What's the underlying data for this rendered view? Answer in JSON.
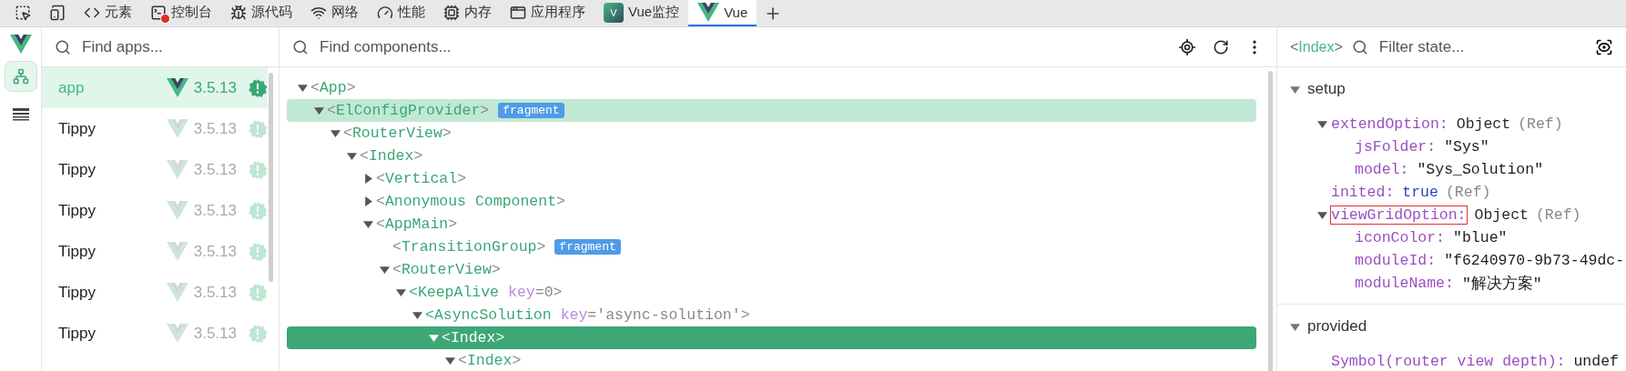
{
  "devtools_tabs": [
    {
      "kind": "inspect",
      "selected": false
    },
    {
      "kind": "device",
      "selected": false
    },
    {
      "kind": "elements",
      "label": "元素",
      "selected": false
    },
    {
      "kind": "console",
      "label": "控制台",
      "selected": false,
      "error": true
    },
    {
      "kind": "sources",
      "label": "源代码",
      "selected": false
    },
    {
      "kind": "network",
      "label": "网络",
      "selected": false
    },
    {
      "kind": "performance",
      "label": "性能",
      "selected": false
    },
    {
      "kind": "memory",
      "label": "内存",
      "selected": false
    },
    {
      "kind": "application",
      "label": "应用程序",
      "selected": false
    },
    {
      "kind": "vue-monitor",
      "label": "Vue监控",
      "letter": "V",
      "selected": false
    },
    {
      "kind": "vue",
      "label": "Vue",
      "selected": true
    }
  ],
  "rail": [
    {
      "kind": "components",
      "selected": true
    },
    {
      "kind": "timeline",
      "selected": false
    }
  ],
  "apps": {
    "search": {
      "placeholder": "Find apps..."
    },
    "items": [
      {
        "name": "app",
        "version": "3.5.13",
        "selected": true
      },
      {
        "name": "Tippy",
        "version": "3.5.13",
        "selected": false
      },
      {
        "name": "Tippy",
        "version": "3.5.13",
        "selected": false
      },
      {
        "name": "Tippy",
        "version": "3.5.13",
        "selected": false
      },
      {
        "name": "Tippy",
        "version": "3.5.13",
        "selected": false
      },
      {
        "name": "Tippy",
        "version": "3.5.13",
        "selected": false
      },
      {
        "name": "Tippy",
        "version": "3.5.13",
        "selected": false
      }
    ]
  },
  "components": {
    "search": {
      "placeholder": "Find components..."
    },
    "tree": [
      {
        "tag": "<App>",
        "kind": "branch",
        "expanded": true,
        "selected": false,
        "highlighted": false,
        "children": [
          {
            "tag": "<ElConfigProvider>",
            "kind": "branch",
            "expanded": true,
            "selected": false,
            "highlighted": true,
            "badge": "fragment",
            "children": [
              {
                "tag": "<RouterView>",
                "kind": "branch",
                "expanded": true,
                "selected": false,
                "highlighted": false,
                "children": [
                  {
                    "tag": "<Index>",
                    "kind": "branch",
                    "expanded": true,
                    "selected": false,
                    "highlighted": false,
                    "children": [
                      {
                        "tag": "<Vertical>",
                        "kind": "branch",
                        "expanded": false,
                        "selected": false,
                        "highlighted": false
                      },
                      {
                        "tag": "<Anonymous Component>",
                        "kind": "branch",
                        "expanded": false,
                        "selected": false,
                        "highlighted": false
                      },
                      {
                        "tag": "<AppMain>",
                        "kind": "branch",
                        "expanded": true,
                        "selected": false,
                        "highlighted": false,
                        "children": [
                          {
                            "tag": "<TransitionGroup>",
                            "kind": "leaf",
                            "selected": false,
                            "highlighted": false,
                            "badge": "fragment"
                          },
                          {
                            "tag": "<RouterView>",
                            "kind": "branch",
                            "expanded": true,
                            "selected": false,
                            "highlighted": false,
                            "children": [
                              {
                                "tag": "<KeepAlive",
                                "kind": "branch",
                                "expanded": true,
                                "selected": false,
                                "highlighted": false,
                                "key": "key",
                                "key_value": "=0",
                                "end": ">",
                                "children": [
                                  {
                                    "tag": "<AsyncSolution",
                                    "kind": "branch",
                                    "expanded": true,
                                    "selected": false,
                                    "highlighted": false,
                                    "key": "key",
                                    "key_value": "='async-solution'",
                                    "end": ">",
                                    "children": [
                                      {
                                        "tag": "<Index>",
                                        "kind": "branch",
                                        "expanded": true,
                                        "selected": true,
                                        "highlighted": false,
                                        "children": [
                                          {
                                            "tag": "<Index>",
                                            "kind": "branch",
                                            "expanded": true,
                                            "selected": false,
                                            "highlighted": false
                                          }
                                        ]
                                      }
                                    ]
                                  }
                                ]
                              }
                            ]
                          }
                        ]
                      }
                    ]
                  }
                ]
              }
            ]
          }
        ]
      }
    ]
  },
  "inspector": {
    "component": "<Index>",
    "search": {
      "placeholder": "Filter state..."
    },
    "sections": [
      {
        "title": "setup",
        "expanded": true,
        "items": [
          {
            "key": "extendOption:",
            "value": "Object",
            "kind": "object",
            "suffix": "(Ref)",
            "boxed": false,
            "expanded": true,
            "children": [
              {
                "key": "jsFolder:",
                "value": "\"Sys\"",
                "kind": "string",
                "boxed": false
              },
              {
                "key": "model:",
                "value": "\"Sys_Solution\"",
                "kind": "string",
                "boxed": false
              }
            ]
          },
          {
            "key": "inited:",
            "value": "true",
            "kind": "boolean",
            "suffix": "(Ref)",
            "boxed": false
          },
          {
            "key": "viewGridOption:",
            "value": "Object",
            "kind": "object",
            "suffix": "(Ref)",
            "boxed": true,
            "expanded": true,
            "children": [
              {
                "key": "iconColor:",
                "value": "\"blue\"",
                "kind": "string",
                "boxed": false
              },
              {
                "key": "moduleId:",
                "value": "\"f6240970-9b73-49dc-",
                "kind": "string",
                "boxed": false
              },
              {
                "key": "moduleName:",
                "value": "\"解决方案\"",
                "kind": "string",
                "boxed": false
              }
            ]
          }
        ]
      },
      {
        "title": "provided",
        "expanded": true,
        "items": [
          {
            "key": "Symbol(router view depth):",
            "value": "undef",
            "kind": "string",
            "boxed": false
          }
        ]
      }
    ]
  }
}
